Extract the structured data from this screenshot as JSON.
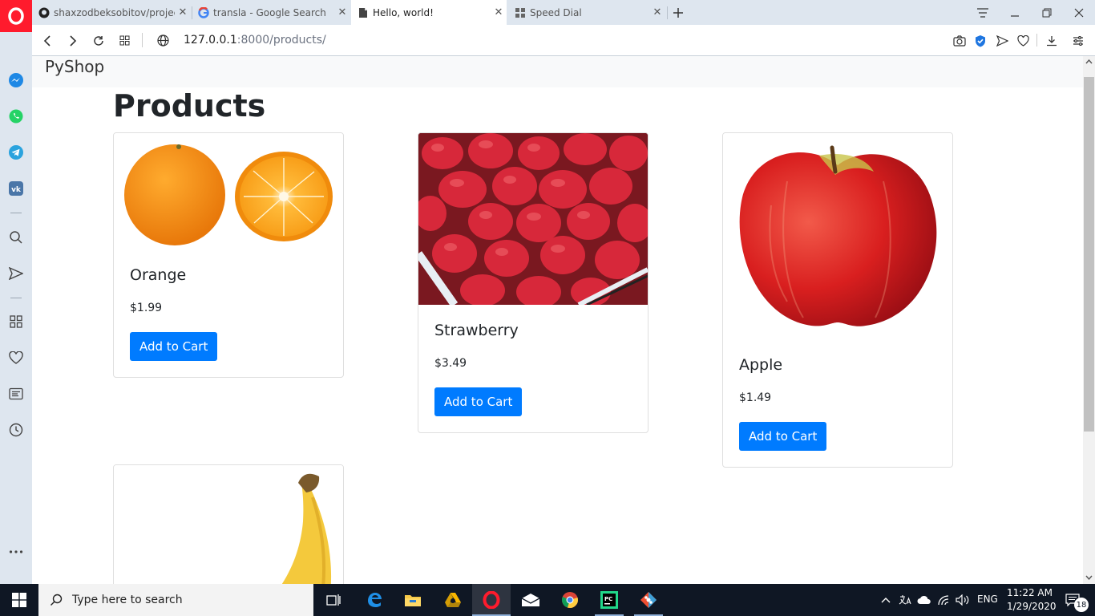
{
  "browser": {
    "tabs": [
      {
        "title": "shaxzodbeksobitov/project",
        "icon": "github-icon"
      },
      {
        "title": "transla - Google Search",
        "icon": "google-icon"
      },
      {
        "title": "Hello, world!",
        "icon": "page-icon"
      },
      {
        "title": "Speed Dial",
        "icon": "speed-dial-icon"
      }
    ],
    "url_host": "127.0.0.1",
    "url_rest": ":8000/products/"
  },
  "site": {
    "brand": "PyShop",
    "heading": "Products"
  },
  "products": [
    {
      "name": "Orange",
      "price": "$1.99",
      "button": "Add to Cart"
    },
    {
      "name": "Strawberry",
      "price": "$3.49",
      "button": "Add to Cart"
    },
    {
      "name": "Apple",
      "price": "$1.49",
      "button": "Add to Cart"
    },
    {
      "name": "Banana"
    }
  ],
  "taskbar": {
    "search_placeholder": "Type here to search",
    "language": "ENG",
    "time": "11:22 AM",
    "date": "1/29/2020",
    "notification_count": "18"
  },
  "colors": {
    "primary_button": "#007bff",
    "navbar_bg": "#f8f9fa",
    "opera_red": "#ff1b2d"
  }
}
